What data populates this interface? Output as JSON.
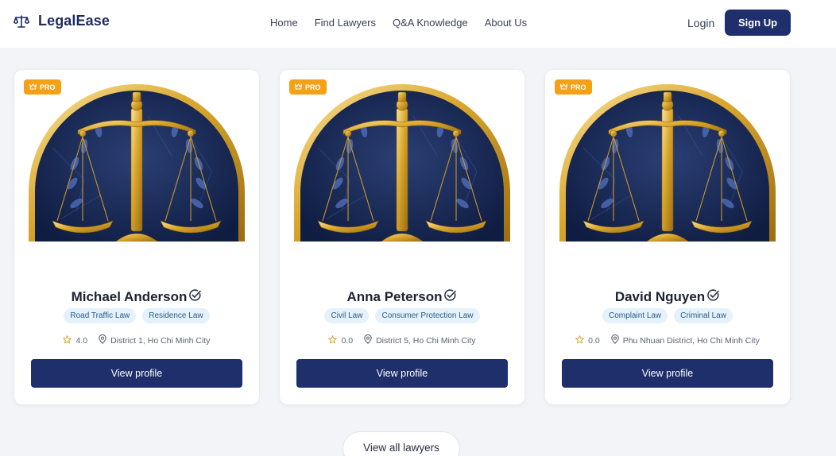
{
  "header": {
    "brand": "LegalEase",
    "nav": [
      "Home",
      "Find Lawyers",
      "Q&A Knowledge",
      "About Us"
    ],
    "login": "Login",
    "signup": "Sign Up"
  },
  "colors": {
    "primary": "#1f2f6b",
    "pro_badge": "#f5a117",
    "tag_bg": "#e5f1fb",
    "star": "#d4a52a"
  },
  "lawyers": [
    {
      "badge": "PRO",
      "name": "Michael Anderson",
      "tags": [
        "Road Traffic Law",
        "Residence Law"
      ],
      "rating": "4.0",
      "location": "District 1, Ho Chi Minh City",
      "button": "View profile"
    },
    {
      "badge": "PRO",
      "name": "Anna Peterson",
      "tags": [
        "Civil Law",
        "Consumer Protection Law"
      ],
      "rating": "0.0",
      "location": "District 5, Ho Chi Minh City",
      "button": "View profile"
    },
    {
      "badge": "PRO",
      "name": "David Nguyen",
      "tags": [
        "Complaint Law",
        "Criminal Law"
      ],
      "rating": "0.0",
      "location": "Phu Nhuan District, Ho Chi Minh City",
      "button": "View profile"
    }
  ],
  "view_all": "View all lawyers",
  "icons": {
    "brand": "scales-icon",
    "badge": "crown-icon",
    "verified": "verified-check-icon",
    "rating": "star-icon",
    "location": "map-pin-icon"
  }
}
